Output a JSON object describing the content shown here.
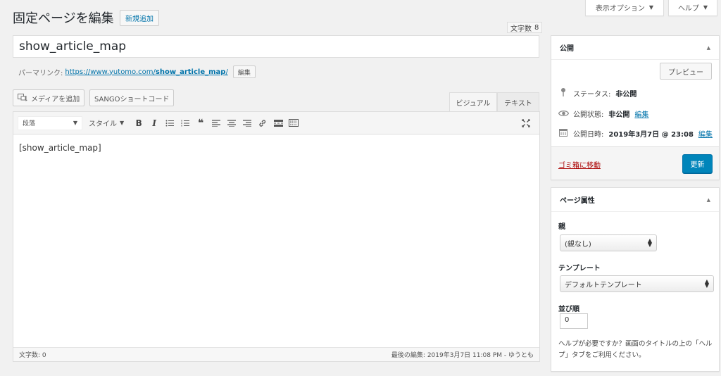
{
  "screen_meta": {
    "options_label": "表示オプション",
    "help_label": "ヘルプ"
  },
  "header": {
    "title": "固定ページを編集",
    "add_new_label": "新規追加",
    "char_count_label": "文字数",
    "char_count_value": "8"
  },
  "post": {
    "title": "show_article_map",
    "permalink_label": "パーマリンク:",
    "permalink_base": "https://www.yutomo.com/",
    "permalink_slug": "show_article_map",
    "permalink_suffix": "/",
    "permalink_edit": "編集"
  },
  "editor": {
    "add_media_label": "メディアを追加",
    "sango_label": "SANGOショートコード",
    "tab_visual": "ビジュアル",
    "tab_text": "テキスト",
    "format_select": "段落",
    "style_select": "スタイル",
    "content": "[show_article_map]",
    "status_wordcount": "文字数: 0",
    "status_last_edit": "最後の編集: 2019年3月7日 11:08 PM - ゆうとも"
  },
  "publish_box": {
    "title": "公開",
    "preview_label": "プレビュー",
    "status_label": "ステータス:",
    "status_value": "非公開",
    "visibility_label": "公開状態:",
    "visibility_value": "非公開",
    "visibility_edit": "編集",
    "date_label": "公開日時:",
    "date_value": "2019年3月7日 @ 23:08",
    "date_edit": "編集",
    "trash_label": "ゴミ箱に移動",
    "update_label": "更新"
  },
  "page_attributes": {
    "title": "ページ属性",
    "parent_label": "親",
    "parent_value": "(親なし)",
    "template_label": "テンプレート",
    "template_value": "デフォルトテンプレート",
    "order_label": "並び順",
    "order_value": "0",
    "help_text": "ヘルプが必要ですか？画面のタイトルの上の「ヘルプ」タブをご利用ください。"
  },
  "colors": {
    "primary_button": "#0085ba",
    "link": "#0073aa",
    "trash": "#a00000",
    "background": "#f1f1f1"
  }
}
